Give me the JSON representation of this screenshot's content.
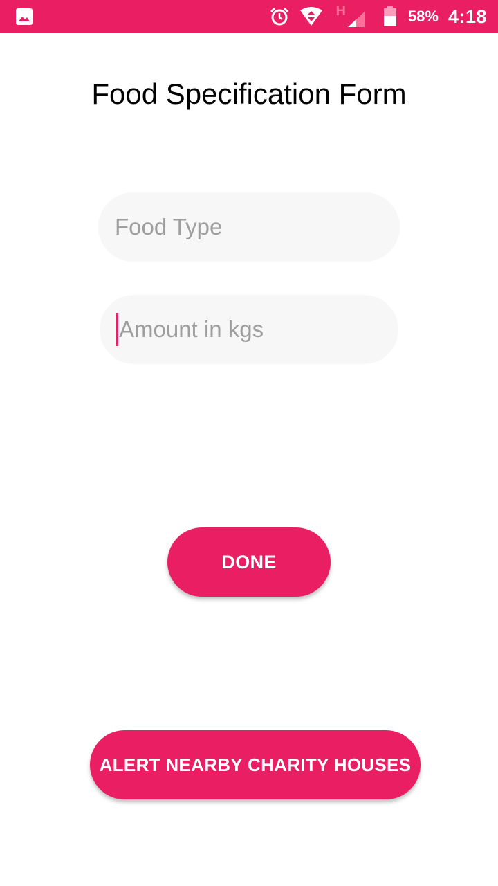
{
  "status_bar": {
    "background": "#e91e63",
    "left_icon": "gallery-icon",
    "icons": [
      "alarm-icon",
      "wifi-icon",
      "signal-icon",
      "battery-icon"
    ],
    "network_type": "H",
    "battery": "58%",
    "time": "4:18"
  },
  "form": {
    "title": "Food Specification Form",
    "food_type": {
      "placeholder": "Food Type",
      "value": ""
    },
    "amount": {
      "placeholder": "Amount in kgs",
      "value": "",
      "focused": true
    }
  },
  "buttons": {
    "done_label": "DONE",
    "alert_label": "ALERT NEARBY CHARITY HOUSES"
  },
  "colors": {
    "accent": "#e91e63",
    "field_bg": "#f7f7f7"
  }
}
